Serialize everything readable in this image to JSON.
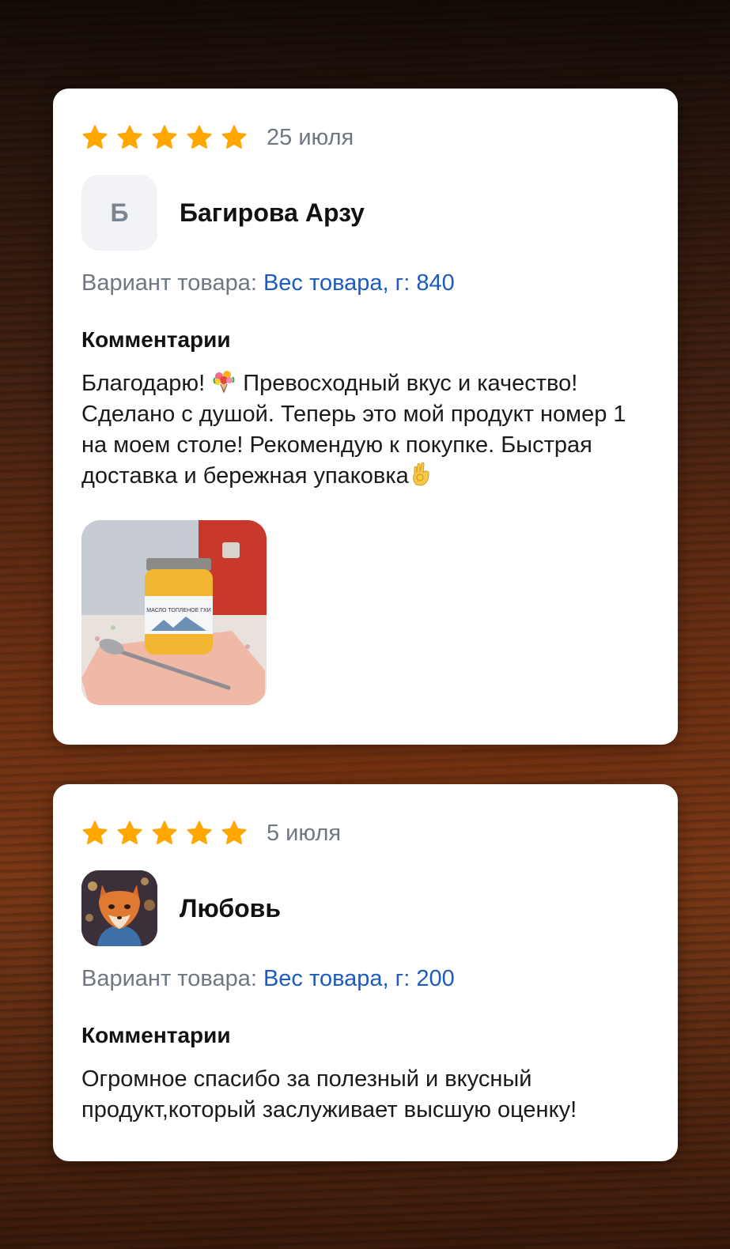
{
  "reviews": [
    {
      "rating": 5,
      "date": "25 июля",
      "avatar_letter": "Б",
      "author": "Багирова Арзу",
      "variant_label": "Вариант товара:",
      "variant_value": "Вес товара, г: 840",
      "comments_label": "Комментарии",
      "comment_parts": [
        "Благодарю! ",
        " Превосходный вкус и качество! Сделано с душой. Теперь это мой продукт номер 1 на моем столе! Рекомендую к покупке. Быстрая доставка и бережная упаковка"
      ],
      "photo_icon": "product-photo-ghee-jar",
      "photo_label": "МАСЛО ТОПЛЕНОЕ ГХИ"
    },
    {
      "rating": 5,
      "date": "5 июля",
      "avatar_icon": "fox-avatar",
      "author": "Любовь",
      "variant_label": "Вариант товара:",
      "variant_value": "Вес товара, г: 200",
      "comments_label": "Комментарии",
      "comment": "Огромное спасибо за полезный и вкусный продукт,который заслуживает высшую оценку!"
    }
  ],
  "colors": {
    "star": "#ffa600",
    "variant_value": "#1d5bbf",
    "muted_text": "#6f7782"
  }
}
